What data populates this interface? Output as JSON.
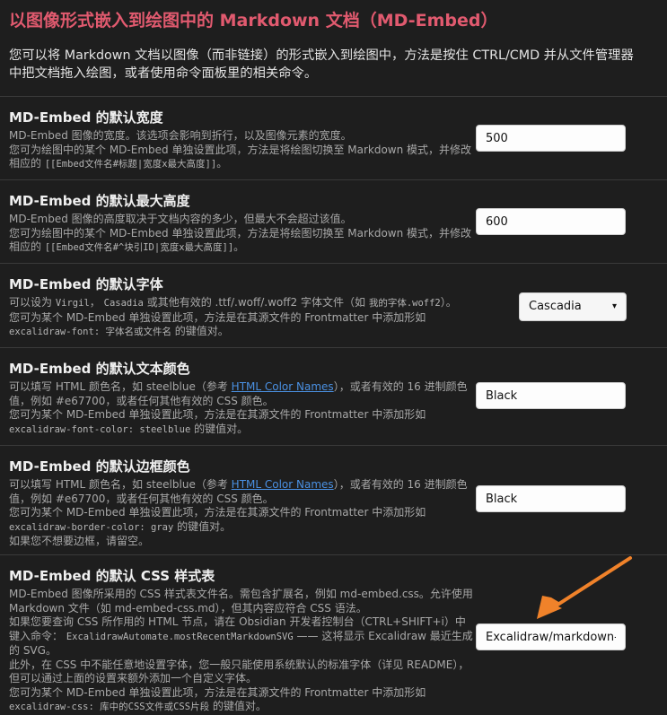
{
  "page": {
    "title": "以图像形式嵌入到绘图中的 Markdown 文档（MD-Embed）",
    "intro": "您可以将 Markdown 文档以图像（而非链接）的形式嵌入到绘图中，方法是按住 CTRL/CMD 并从文件管理器中把文档拖入绘图，或者使用命令面板里的相关命令。"
  },
  "settings": {
    "width": {
      "name": "MD-Embed 的默认宽度",
      "desc1": "MD-Embed 图像的宽度。该选项会影响到折行，以及图像元素的宽度。",
      "desc2": "您可为绘图中的某个 MD-Embed 单独设置此项，方法是将绘图切换至 Markdown 模式，并修改相应的",
      "code": "[[Embed文件名#标题|宽度x最大高度]]",
      "desc3": "。",
      "value": "500"
    },
    "height": {
      "name": "MD-Embed 的默认最大高度",
      "desc1": "MD-Embed 图像的高度取决于文档内容的多少，但最大不会超过该值。",
      "desc2": "您可为绘图中的某个 MD-Embed 单独设置此项，方法是将绘图切换至 Markdown 模式，并修改相应的",
      "code": "[[Embed文件名#^块引ID|宽度x最大高度]]",
      "desc3": "。",
      "value": "600"
    },
    "font": {
      "name": "MD-Embed 的默认字体",
      "desc1a": "可以设为",
      "code1": "Virgil",
      "desc1b": "，",
      "code2": "Casadia",
      "desc1c": "或其他有效的 .ttf/.woff/.woff2 字体文件（如",
      "code3": "我的字体.woff2",
      "desc1d": "）。",
      "desc2": "您可为某个 MD-Embed 单独设置此项，方法是在其源文件的 Frontmatter 中添加形如",
      "code4": "excalidraw-font: 字体名或文件名",
      "desc3": "的键值对。",
      "value": "Cascadia",
      "caret": "▾"
    },
    "textcolor": {
      "name": "MD-Embed 的默认文本颜色",
      "desc1a": "可以填写 HTML 颜色名，如 steelblue（参考",
      "link": "HTML Color Names",
      "desc1b": "），或者有效的 16 进制颜色值，例如 #e67700，或者任何其他有效的 CSS 颜色。",
      "desc2": "您可为某个 MD-Embed 单独设置此项，方法是在其源文件的 Frontmatter 中添加形如",
      "code": "excalidraw-font-color: steelblue",
      "desc3": "的键值对。",
      "value": "Black"
    },
    "bordercolor": {
      "name": "MD-Embed 的默认边框颜色",
      "desc1a": "可以填写 HTML 颜色名，如 steelblue（参考",
      "link": "HTML Color Names",
      "desc1b": "），或者有效的 16 进制颜色值，例如 #e67700，或者任何其他有效的 CSS 颜色。",
      "desc2": "您可为某个 MD-Embed 单独设置此项，方法是在其源文件的 Frontmatter 中添加形如",
      "code": "excalidraw-border-color: gray",
      "desc3": "的键值对。",
      "desc4": "如果您不想要边框，请留空。",
      "value": "Black"
    },
    "css": {
      "name": "MD-Embed 的默认 CSS 样式表",
      "desc1": "MD-Embed 图像所采用的 CSS 样式表文件名。需包含扩展名，例如 md-embed.css。允许使用 Markdown 文件（如 md-embed-css.md），但其内容应符合 CSS 语法。",
      "desc2a": "如果您要查询 CSS 所作用的 HTML 节点，请在 Obsidian 开发者控制台（CTRL+SHIFT+i）中键入命令：",
      "code1": "ExcalidrawAutomate.mostRecentMarkdownSVG",
      "desc2b": "—— 这将显示 Excalidraw 最近生成的 SVG。",
      "desc3": "此外，在 CSS 中不能任意地设置字体，您一般只能使用系统默认的标准字体（详见 README），但可以通过上面的设置来额外添加一个自定义字体。",
      "desc4": "您可为某个 MD-Embed 单独设置此项，方法是在其源文件的 Frontmatter 中添加形如",
      "code2": "excalidraw-css: 库中的CSS文件或CSS片段",
      "desc5": "的键值对。",
      "value": "Excalidraw/markdown-css"
    }
  },
  "colors": {
    "title": "#e15a6f",
    "arrow": "#f0822a",
    "link": "#4a90e2"
  }
}
